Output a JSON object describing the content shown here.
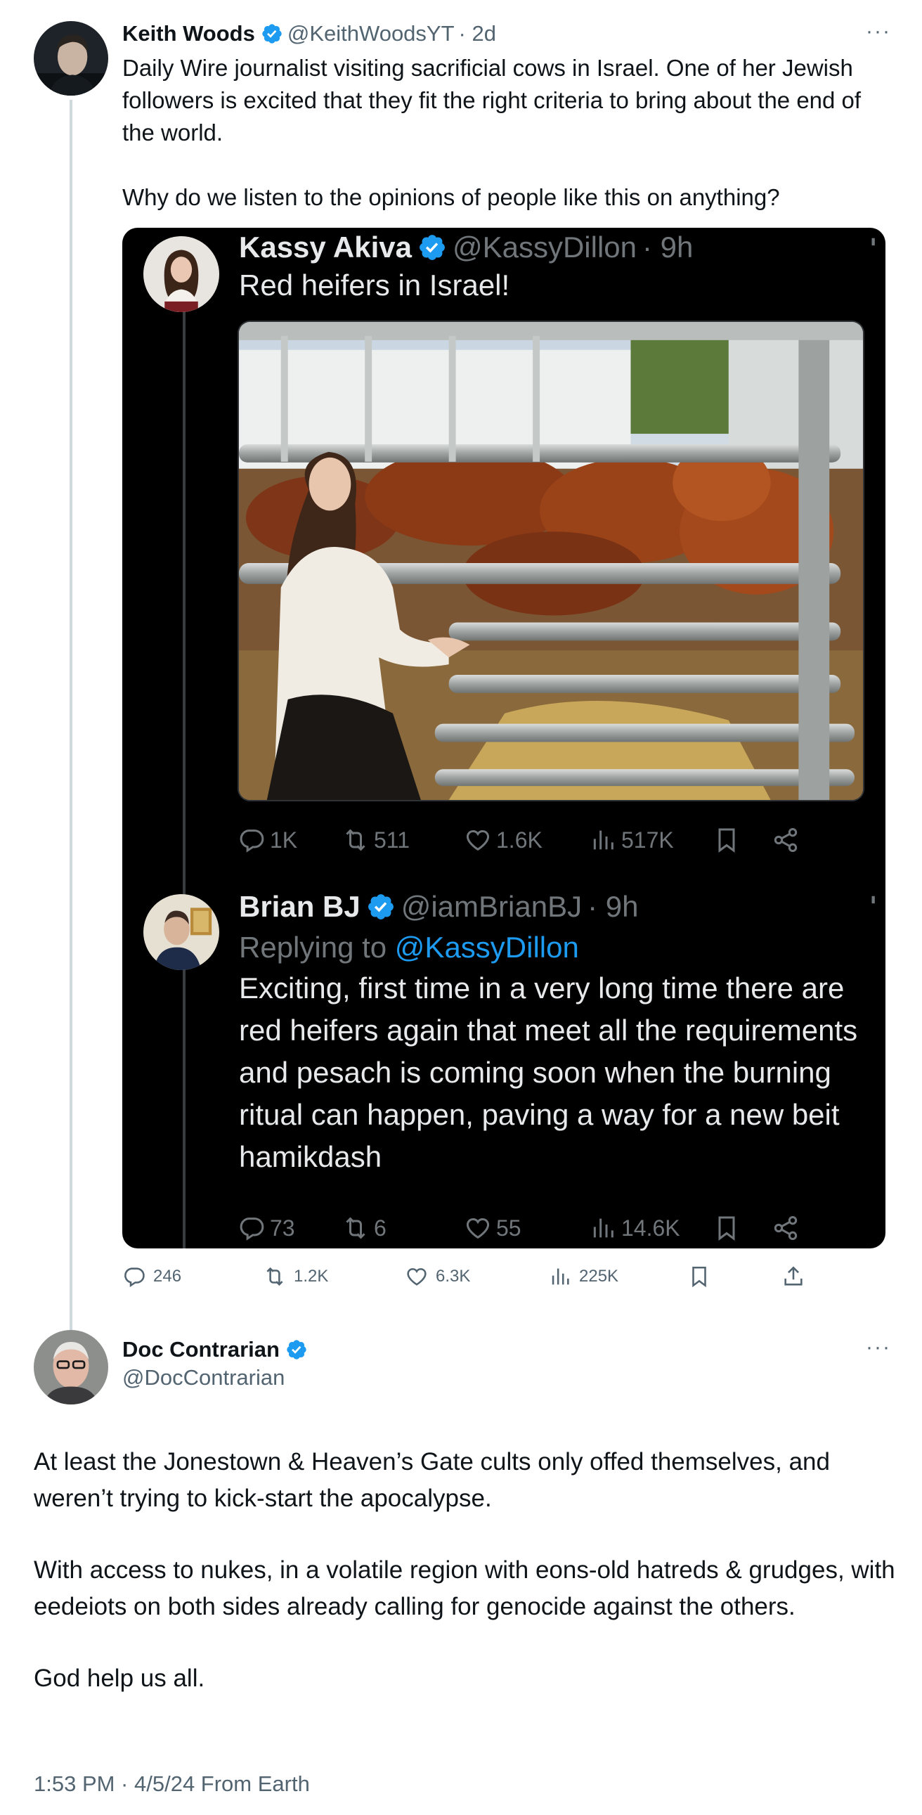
{
  "outer_tweet": {
    "name": "Keith Woods",
    "handle": "@KeithWoodsYT",
    "time": "· 2d",
    "more": "···",
    "text_p1": "Daily Wire journalist visiting sacrificial cows in Israel. One of her Jewish followers is excited that they fit the right criteria to bring about the end of the world.",
    "text_p2": "Why do we listen to the opinions of people like this on anything?",
    "actions": {
      "replies": "246",
      "reposts": "1.2K",
      "likes": "6.3K",
      "views": "225K"
    }
  },
  "embedded": {
    "tweet1": {
      "name": "Kassy Akiva",
      "handle": "@KassyDillon",
      "time": "· 9h",
      "more": "···",
      "text": "Red heifers in Israel!",
      "actions": {
        "replies": "1K",
        "reposts": "511",
        "likes": "1.6K",
        "views": "517K"
      }
    },
    "tweet2": {
      "name": "Brian BJ",
      "handle": "@iamBrianBJ",
      "time": "· 9h",
      "more": "···",
      "replying_prefix": "Replying to ",
      "replying_to": "@KassyDillon",
      "text": "Exciting, first time in a very long time there are red heifers again that meet all the requirements and pesach is coming soon when the burning ritual can happen, paving a way for a new beit hamikdash",
      "actions": {
        "replies": "73",
        "reposts": "6",
        "likes": "55",
        "views": "14.6K"
      }
    }
  },
  "reply_tweet": {
    "name": "Doc Contrarian",
    "handle": "@DocContrarian",
    "more": "···",
    "text_p1": "At least the Jonestown & Heaven’s Gate cults only offed themselves, and weren’t trying to kick-start the apocalypse.",
    "text_p2": "With access to nukes, in a volatile region with eons-old hatreds & grudges, with eedeiots on both sides already calling for genocide against the others.",
    "text_p3": "God help us all.",
    "timestamp": "1:53 PM · 4/5/24 From Earth"
  },
  "colors": {
    "verified": "#1d9bf0",
    "text_primary": "#0f1419",
    "text_secondary": "#536471",
    "embed_bg": "#000000"
  },
  "icons": [
    "verified-badge-icon",
    "more-icon",
    "reply-icon",
    "repost-icon",
    "like-icon",
    "views-icon",
    "bookmark-icon",
    "share-icon"
  ]
}
